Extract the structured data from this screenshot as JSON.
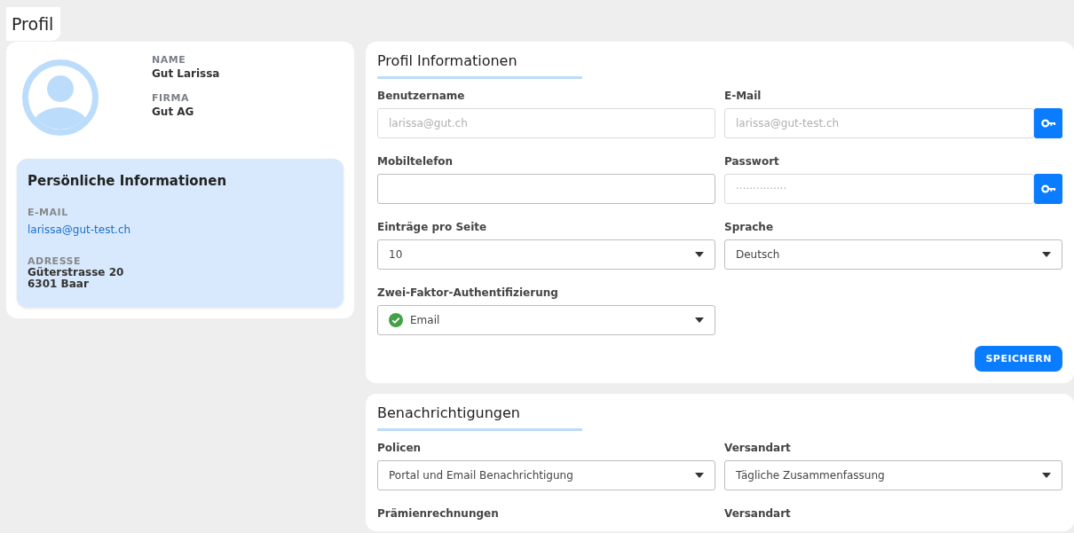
{
  "page_title": "Profil",
  "profile_card": {
    "name_label": "NAME",
    "name": "Gut Larissa",
    "company_label": "FIRMA",
    "company": "Gut AG",
    "personal": {
      "title": "Persönliche Informationen",
      "email_label": "E-MAIL",
      "email": "larissa@gut-test.ch",
      "address_label": "ADRESSE",
      "address_lines": [
        "Güterstrasse 20",
        "6301 Baar"
      ]
    }
  },
  "profile_info": {
    "title": "Profil Informationen",
    "fields": [
      {
        "label": "Benutzername",
        "kind": "input",
        "value": "larissa@gut.ch",
        "disabled": true,
        "key_button": false
      },
      {
        "label": "E-Mail",
        "kind": "input",
        "value": "larissa@gut-test.ch",
        "disabled": true,
        "key_button": true
      },
      {
        "label": "Mobiltelefon",
        "kind": "input",
        "disabled": false,
        "key_button": false
      },
      {
        "label": "Passwort",
        "kind": "input",
        "value": "···············",
        "disabled": true,
        "key_button": true
      },
      {
        "label": "Einträge pro Seite",
        "kind": "select",
        "value": "10",
        "checked": false
      },
      {
        "label": "Sprache",
        "kind": "select",
        "value": "Deutsch",
        "checked": false
      },
      {
        "label": "Zwei-Faktor-Authentifizierung",
        "kind": "select",
        "value": "Email",
        "checked": true
      }
    ],
    "save_button": "SPEICHERN"
  },
  "notifications": {
    "title": "Benachrichtigungen",
    "fields": [
      {
        "label": "Policen",
        "kind": "select",
        "value": "Portal und Email Benachrichtigung",
        "checked": false
      },
      {
        "label": "Versandart",
        "kind": "select",
        "value": "Tägliche Zusammenfassung",
        "checked": false
      },
      {
        "label": "Prämienrechnungen",
        "kind": "label"
      },
      {
        "label": "Versandart",
        "kind": "label"
      }
    ]
  }
}
